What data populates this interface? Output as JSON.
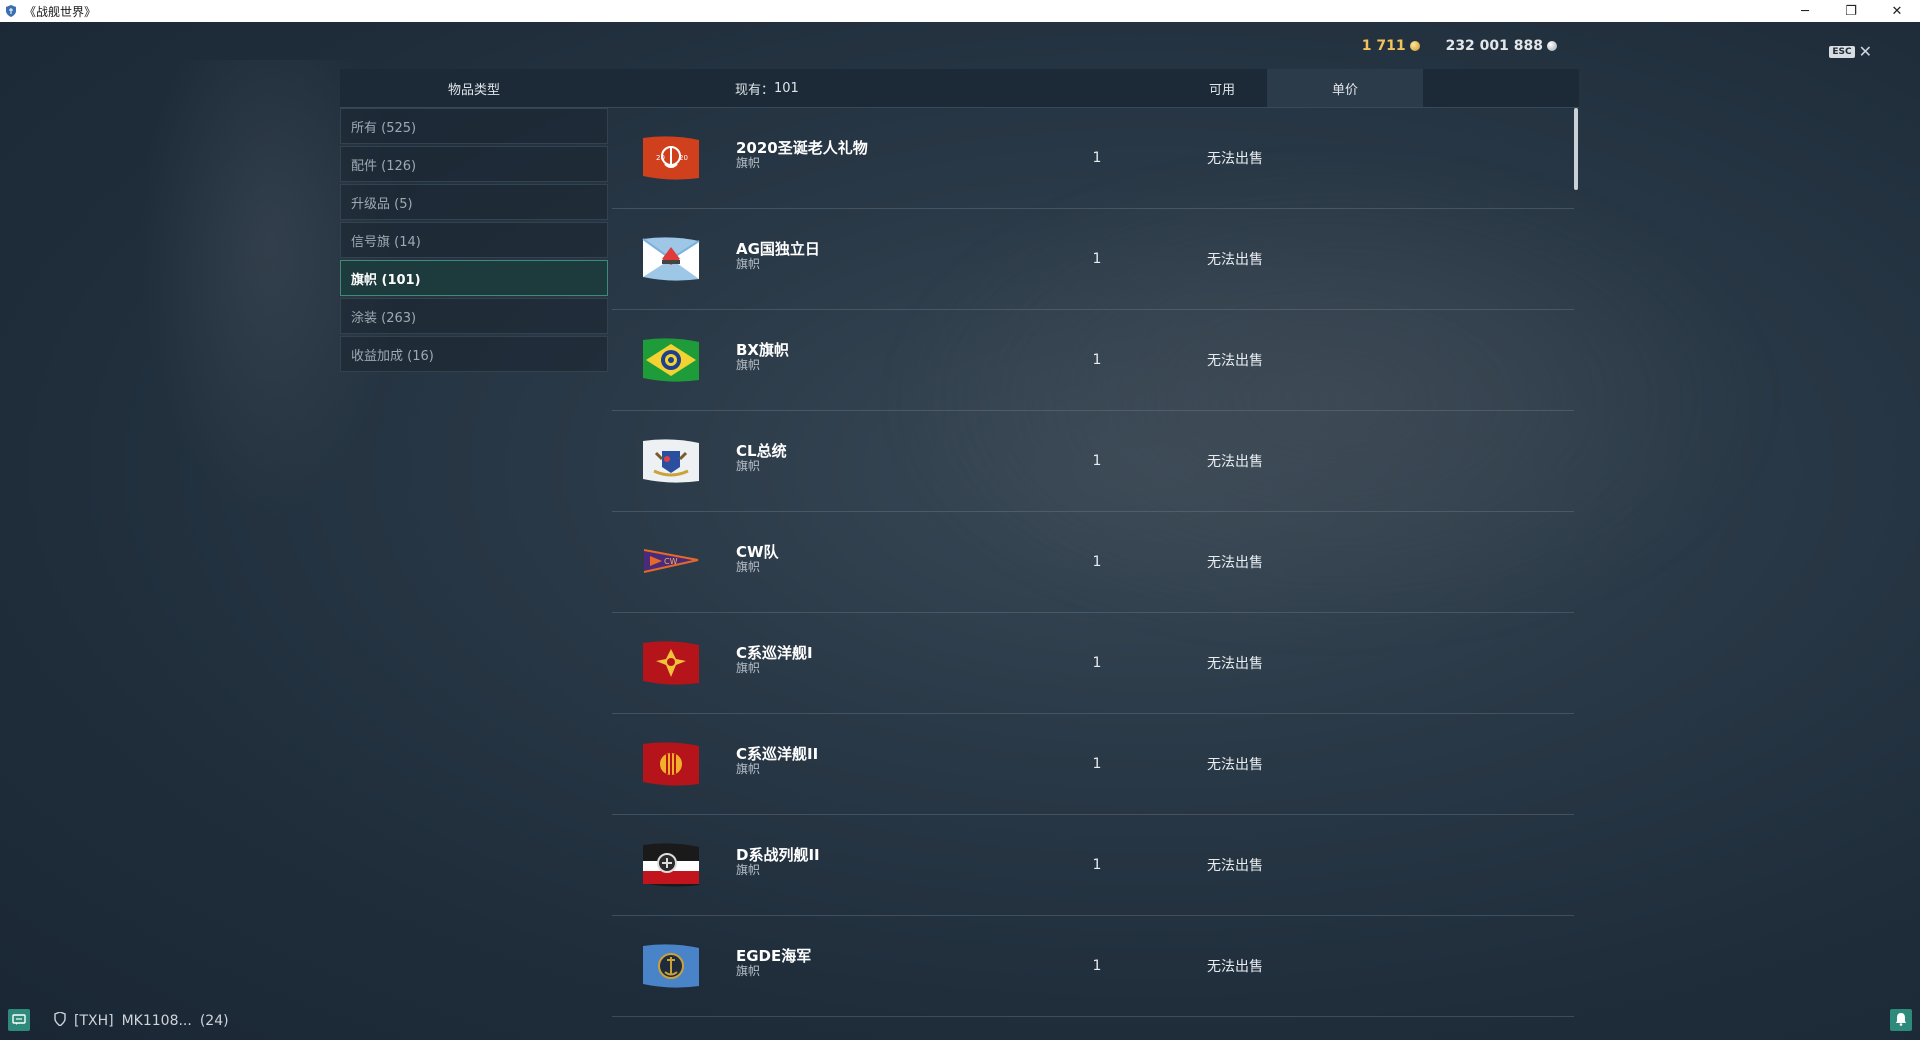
{
  "window": {
    "title": "《战舰世界》",
    "minimize": "─",
    "restore": "❐",
    "close": "✕"
  },
  "currency": {
    "gold": "1 711",
    "silver": "232 001 888"
  },
  "esc": {
    "key": "ESC",
    "close": "✕"
  },
  "header": {
    "item_type": "物品类型",
    "count_label": "现有：",
    "count_value": "101",
    "available": "可用",
    "unit_price": "单价"
  },
  "sidebar": {
    "items": [
      {
        "label": "所有 (525)",
        "active": false
      },
      {
        "label": "配件 (126)",
        "active": false
      },
      {
        "label": "升级品 (5)",
        "active": false
      },
      {
        "label": "信号旗 (14)",
        "active": false
      },
      {
        "label": "旗帜 (101)",
        "active": true
      },
      {
        "label": "涂装 (263)",
        "active": false
      },
      {
        "label": "收益加成 (16)",
        "active": false
      }
    ]
  },
  "items": [
    {
      "name": "2020圣诞老人礼物",
      "type": "旗帜",
      "available": "1",
      "price": "无法出售",
      "icon": "flag-christmas-2020-icon"
    },
    {
      "name": "AG国独立日",
      "type": "旗帜",
      "available": "1",
      "price": "无法出售",
      "icon": "flag-ag-independence-icon"
    },
    {
      "name": "BX旗帜",
      "type": "旗帜",
      "available": "1",
      "price": "无法出售",
      "icon": "flag-bx-icon"
    },
    {
      "name": "CL总统",
      "type": "旗帜",
      "available": "1",
      "price": "无法出售",
      "icon": "flag-cl-president-icon"
    },
    {
      "name": "CW队",
      "type": "旗帜",
      "available": "1",
      "price": "无法出售",
      "icon": "flag-cw-team-icon"
    },
    {
      "name": "C系巡洋舰I",
      "type": "旗帜",
      "available": "1",
      "price": "无法出售",
      "icon": "flag-c-cruiser-1-icon"
    },
    {
      "name": "C系巡洋舰II",
      "type": "旗帜",
      "available": "1",
      "price": "无法出售",
      "icon": "flag-c-cruiser-2-icon"
    },
    {
      "name": "D系战列舰II",
      "type": "旗帜",
      "available": "1",
      "price": "无法出售",
      "icon": "flag-d-battleship-2-icon"
    },
    {
      "name": "EGDE海军",
      "type": "旗帜",
      "available": "1",
      "price": "无法出售",
      "icon": "flag-egde-navy-icon"
    }
  ],
  "bottom": {
    "clan": "[TXH]",
    "player": "MK1108...",
    "count": "(24)"
  },
  "colors": {
    "accent": "#3f8a7a",
    "gold": "#f2c45a",
    "header_bg": "#1c2a37"
  }
}
